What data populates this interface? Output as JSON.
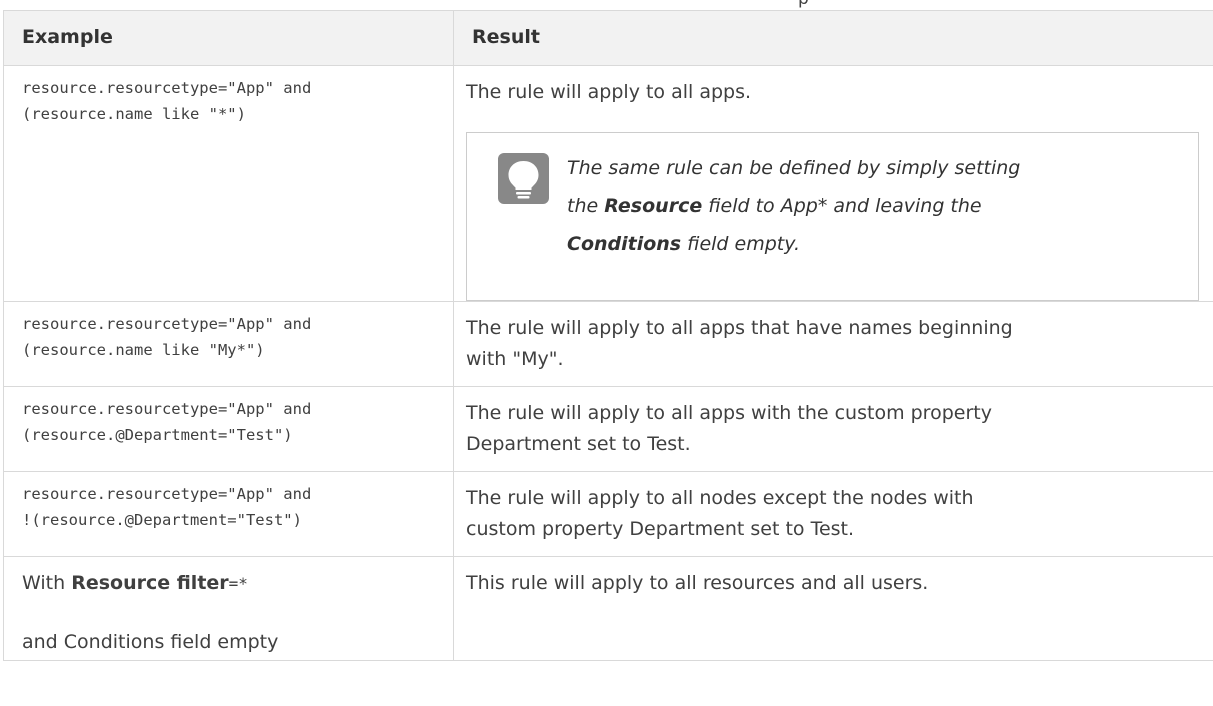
{
  "caption_fragment": "p",
  "table": {
    "headers": [
      "Example",
      "Result"
    ],
    "row1": {
      "code_line1": "resource.resourcetype=\"App\" and",
      "code_line2": "(resource.name like \"*\")",
      "result": "The rule will apply to all apps.",
      "tip": {
        "icon": "lightbulb-icon",
        "t1": "The same rule can be defined by simply setting",
        "t2": "the ",
        "t3": "Resource",
        "t4": " field to App* and leaving the",
        "t5": "Conditions",
        "t6": " field empty."
      }
    },
    "row2": {
      "code_line1": "resource.resourcetype=\"App\" and",
      "code_line2": "(resource.name like \"My*\")",
      "result_line1": "The rule will apply to all apps that have names beginning",
      "result_line2": "with \"My\"."
    },
    "row3": {
      "code_line1": "resource.resourcetype=\"App\" and",
      "code_line2": "(resource.@Department=\"Test\")",
      "result_line1": "The rule will apply to all apps with the custom property",
      "result_line2": "Department set to Test."
    },
    "row4": {
      "code_line1": "resource.resourcetype=\"App\" and",
      "code_line2": "!(resource.@Department=\"Test\")",
      "result_line1": "The rule will apply to all nodes except the nodes with",
      "result_line2": "custom property Department set to Test."
    },
    "row5": {
      "p1_pre": "With ",
      "p1_bold": "Resource filter",
      "p1_code": "=*",
      "p2": "and Conditions field empty",
      "result": "This rule will apply to all resources and all users."
    }
  }
}
